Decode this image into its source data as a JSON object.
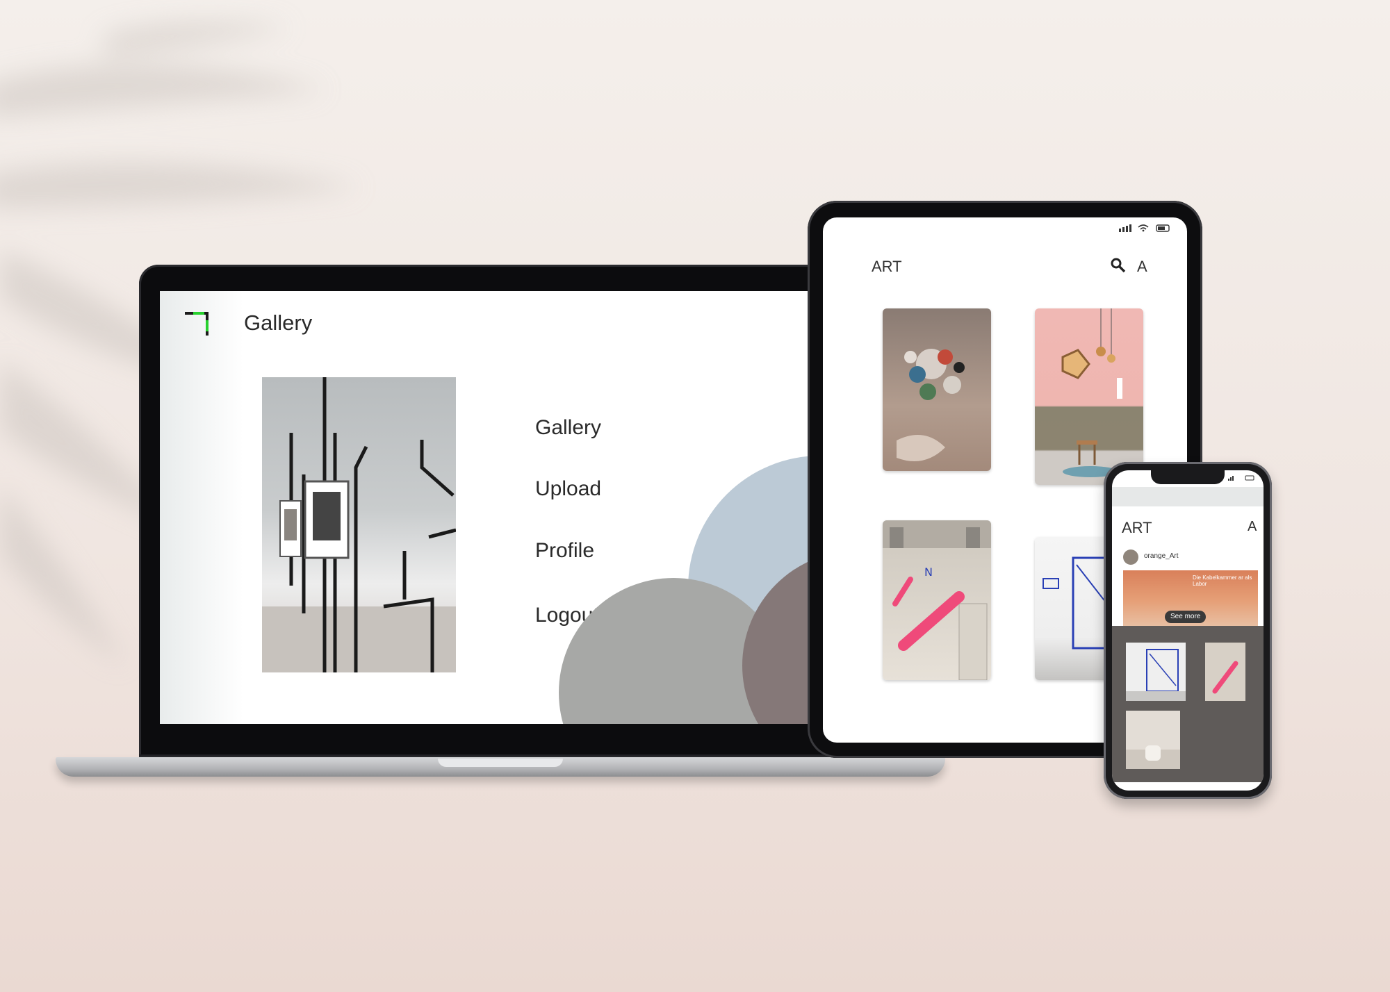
{
  "laptop": {
    "app_title": "Gallery",
    "menu": [
      {
        "label": "Gallery"
      },
      {
        "label": "Upload"
      },
      {
        "label": "Profile"
      },
      {
        "label": "Logout"
      }
    ],
    "colors": {
      "logo_green": "#27d12f",
      "blob_blue": "#bccad6",
      "blob_gray": "#a7a8a6",
      "blob_mauve": "#857878"
    }
  },
  "tablet": {
    "title": "ART",
    "search_icon": "search-icon",
    "avatar_letter": "A"
  },
  "phone": {
    "title": "ART",
    "avatar_letter": "A",
    "username": "orange_Art",
    "post_caption": "Die Kabelkammer ar als Labor",
    "see_more_label": "See more"
  }
}
